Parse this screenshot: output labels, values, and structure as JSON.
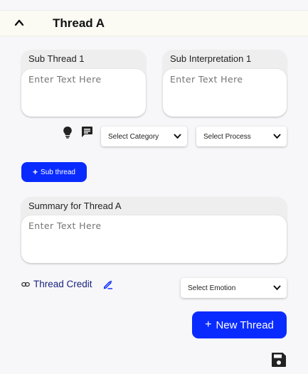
{
  "header": {
    "title": "Thread A",
    "collapse_icon": "chevron-up-icon"
  },
  "sub_thread": {
    "label": "Sub Thread 1",
    "placeholder": "Enter Text Here"
  },
  "sub_interpretation": {
    "label": "Sub Interpretation 1",
    "placeholder": "Enter Text Here"
  },
  "toolbar": {
    "icons": [
      "lightbulb-icon",
      "comment-icon"
    ],
    "category_select": "Select Category",
    "process_select": "Select Process"
  },
  "sub_thread_button": "Sub thread",
  "summary": {
    "label": "Summary for Thread A",
    "placeholder": "Enter Text Here"
  },
  "credit": {
    "label": "Thread Credit",
    "icons": [
      "link-icon",
      "edit-icon"
    ]
  },
  "emotion_select": "Select Emotion",
  "new_thread_button": "New Thread",
  "save_icon": "save-icon",
  "colors": {
    "accent": "#0a2bff",
    "credit_text": "#1a237e"
  }
}
